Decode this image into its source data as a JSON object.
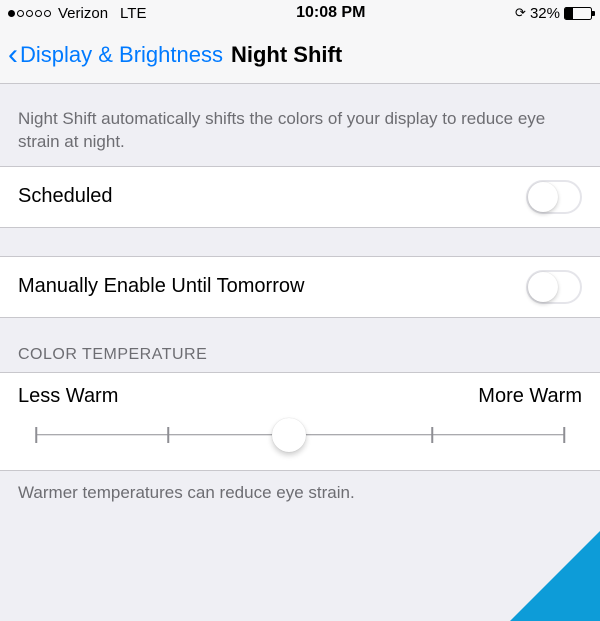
{
  "status": {
    "carrier": "Verizon",
    "network": "LTE",
    "time": "10:08 PM",
    "battery_pct": "32%"
  },
  "nav": {
    "back_label": "Display & Brightness",
    "title": "Night Shift"
  },
  "intro": "Night Shift automatically shifts the colors of your display to reduce eye strain at night.",
  "rows": {
    "scheduled": "Scheduled",
    "manual": "Manually Enable Until Tomorrow"
  },
  "temp": {
    "header": "COLOR TEMPERATURE",
    "min_label": "Less Warm",
    "max_label": "More Warm",
    "footer": "Warmer temperatures can reduce eye strain."
  }
}
